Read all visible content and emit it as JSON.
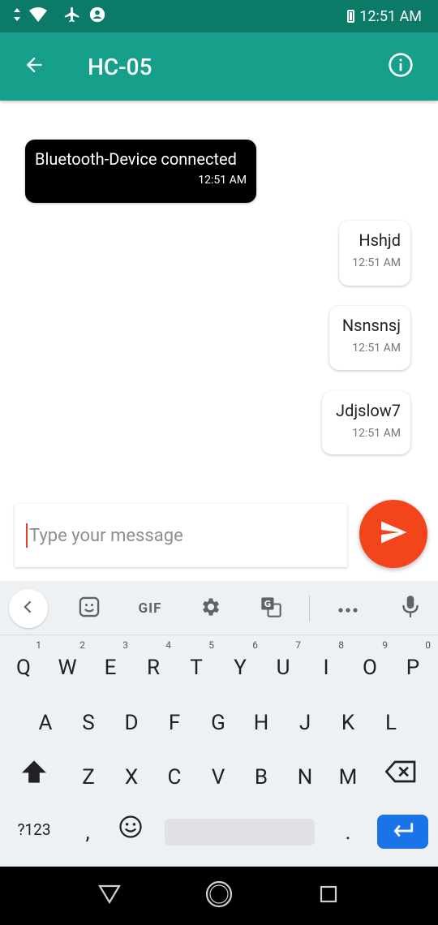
{
  "status_bar": {
    "time": "12:51 AM",
    "icons": [
      "data-arrows-icon",
      "wifi-icon",
      "airplane-icon",
      "account-circle-icon",
      "battery-icon"
    ]
  },
  "app_bar": {
    "title": "HC-05",
    "back_icon": "arrow-back-icon",
    "info_icon": "info-icon",
    "color": "#16a08c"
  },
  "messages": [
    {
      "text": "Bluetooth-Device connected",
      "time": "12:51 AM",
      "type": "system"
    },
    {
      "text": "Hshjd",
      "time": "12:51 AM",
      "type": "sent"
    },
    {
      "text": "Nsnsnsj",
      "time": "12:51 AM",
      "type": "sent"
    },
    {
      "text": "Jdjslow7",
      "time": "12:51 AM",
      "type": "sent"
    }
  ],
  "compose": {
    "placeholder": "Type your message",
    "send_icon": "send-icon",
    "send_color": "#f4441b"
  },
  "keyboard": {
    "toolbar": [
      "back-chevron-icon",
      "sticker-icon",
      "GIF",
      "settings-icon",
      "translate-icon",
      "more-icon",
      "mic-icon"
    ],
    "gif_label": "GIF",
    "row1": [
      "Q",
      "W",
      "E",
      "R",
      "T",
      "Y",
      "U",
      "I",
      "O",
      "P"
    ],
    "row1_hints": [
      "1",
      "2",
      "3",
      "4",
      "5",
      "6",
      "7",
      "8",
      "9",
      "0"
    ],
    "row2": [
      "A",
      "S",
      "D",
      "F",
      "G",
      "H",
      "J",
      "K",
      "L"
    ],
    "row3": [
      "Z",
      "X",
      "C",
      "V",
      "B",
      "N",
      "M"
    ],
    "symbols_label": "?123",
    "comma": ",",
    "period": ".",
    "enter_color": "#1a73e8"
  },
  "nav_bar": {
    "icons": [
      "nav-back-icon",
      "nav-home-icon",
      "nav-recents-icon"
    ]
  }
}
